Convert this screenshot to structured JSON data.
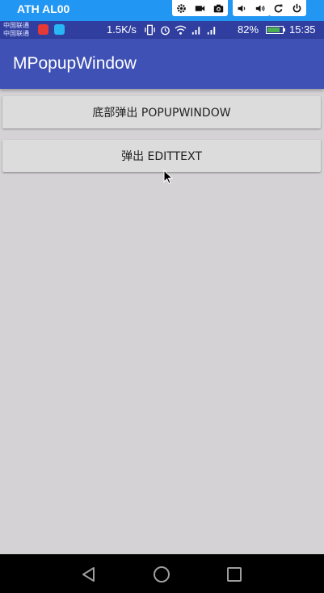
{
  "host": {
    "title": "ATH AL00"
  },
  "status": {
    "carrier_line1": "中国联通",
    "carrier_line2": "中国联通",
    "net_speed": "1.5K/s",
    "battery": "82%",
    "battery_level": 0.82,
    "time": "15:35"
  },
  "app": {
    "title": "MPopupWindow"
  },
  "buttons": {
    "bottom_popup": "底部弹出 POPUPWINDOW",
    "edittext": "弹出 EDITTEXT"
  },
  "colors": {
    "host_bar": "#2196f3",
    "status_bar": "#303f9f",
    "action_bar": "#3f51b5",
    "background": "#d4d2d4",
    "button": "#dcdcdc"
  }
}
